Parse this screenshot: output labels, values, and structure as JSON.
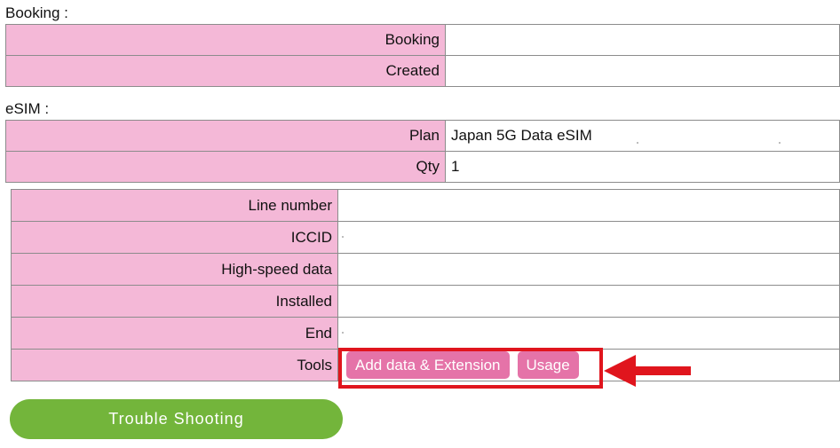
{
  "booking_section": {
    "title": "Booking :",
    "rows": [
      {
        "label": "Booking",
        "value": ""
      },
      {
        "label": "Created",
        "value": ""
      }
    ]
  },
  "esim_section": {
    "title": "eSIM :",
    "rows": [
      {
        "label": "Plan",
        "value": "Japan 5G Data eSIM"
      },
      {
        "label": "Qty",
        "value": "1"
      }
    ]
  },
  "line_details": {
    "rows": [
      {
        "label": "Line number",
        "value": ""
      },
      {
        "label": "ICCID",
        "value": ""
      },
      {
        "label": "High-speed data",
        "value": ""
      },
      {
        "label": "Installed",
        "value": ""
      },
      {
        "label": "End",
        "value": ""
      }
    ],
    "tools": {
      "label": "Tools",
      "add_data_button": "Add data & Extension",
      "usage_button": "Usage"
    }
  },
  "trouble_shooting_button": "Trouble Shooting",
  "colors": {
    "label_bg": "#f4b8d7",
    "tool_button_bg": "#e573a8",
    "highlight": "#e0151d",
    "trouble_button_bg": "#73b53b"
  },
  "annotation": {
    "highlight_icon": "red-rectangle",
    "arrow_icon": "red-arrow-left"
  }
}
